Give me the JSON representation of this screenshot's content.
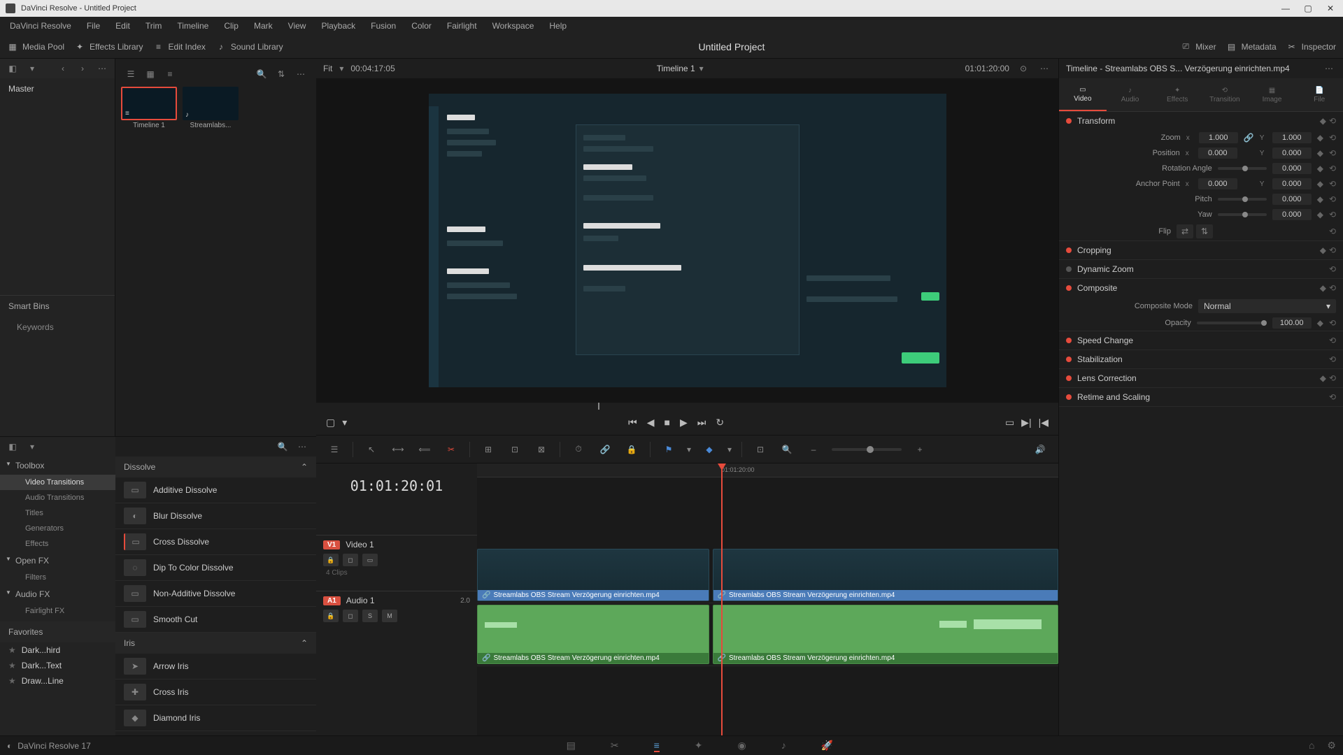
{
  "window": {
    "title": "DaVinci Resolve - Untitled Project"
  },
  "menubar": [
    "DaVinci Resolve",
    "File",
    "Edit",
    "Trim",
    "Timeline",
    "Clip",
    "Mark",
    "View",
    "Playback",
    "Fusion",
    "Color",
    "Fairlight",
    "Workspace",
    "Help"
  ],
  "toolbar": {
    "media_pool": "Media Pool",
    "effects_library": "Effects Library",
    "edit_index": "Edit Index",
    "sound_library": "Sound Library",
    "mixer": "Mixer",
    "metadata": "Metadata",
    "inspector": "Inspector",
    "project_title": "Untitled Project"
  },
  "media": {
    "master": "Master",
    "smart_bins": "Smart Bins",
    "keywords": "Keywords",
    "thumbs": [
      {
        "label": "Timeline 1",
        "icon": "≡"
      },
      {
        "label": "Streamlabs...",
        "icon": "♪"
      }
    ]
  },
  "effects": {
    "toolbox": "Toolbox",
    "categories": [
      {
        "label": "Video Transitions",
        "active": true
      },
      {
        "label": "Audio Transitions",
        "active": false
      },
      {
        "label": "Titles",
        "active": false
      },
      {
        "label": "Generators",
        "active": false
      },
      {
        "label": "Effects",
        "active": false
      }
    ],
    "openfx": "Open FX",
    "filters": "Filters",
    "audiofx": "Audio FX",
    "fairlightfx": "Fairlight FX",
    "favorites": "Favorites",
    "fav_items": [
      "Dark...hird",
      "Dark...Text",
      "Draw...Line"
    ],
    "groups": [
      {
        "name": "Dissolve",
        "items": [
          "Additive Dissolve",
          "Blur Dissolve",
          "Cross Dissolve",
          "Dip To Color Dissolve",
          "Non-Additive Dissolve",
          "Smooth Cut"
        ]
      },
      {
        "name": "Iris",
        "items": [
          "Arrow Iris",
          "Cross Iris",
          "Diamond Iris"
        ]
      }
    ]
  },
  "viewer": {
    "fit": "Fit",
    "tc_left": "00:04:17:05",
    "timeline_name": "Timeline 1",
    "tc_right": "01:01:20:00"
  },
  "timeline": {
    "display_tc": "01:01:20:01",
    "ruler_label": "01:01:20:00",
    "video_track": {
      "badge": "V1",
      "name": "Video 1",
      "clip_count": "4 Clips"
    },
    "audio_track": {
      "badge": "A1",
      "name": "Audio 1",
      "channels": "2.0"
    },
    "clip_name": "Streamlabs OBS Stream Verzögerung einrichten.mp4"
  },
  "inspector": {
    "header": "Timeline - Streamlabs OBS S... Verzögerung einrichten.mp4",
    "tabs": [
      "Video",
      "Audio",
      "Effects",
      "Transition",
      "Image",
      "File"
    ],
    "transform": {
      "title": "Transform",
      "zoom": "Zoom",
      "zoom_x": "1.000",
      "zoom_y": "1.000",
      "position": "Position",
      "pos_x": "0.000",
      "pos_y": "0.000",
      "rotation": "Rotation Angle",
      "rot_val": "0.000",
      "anchor": "Anchor Point",
      "anc_x": "0.000",
      "anc_y": "0.000",
      "pitch": "Pitch",
      "pitch_val": "0.000",
      "yaw": "Yaw",
      "yaw_val": "0.000",
      "flip": "Flip"
    },
    "cropping": "Cropping",
    "dynamic_zoom": "Dynamic Zoom",
    "composite": {
      "title": "Composite",
      "mode_label": "Composite Mode",
      "mode_value": "Normal",
      "opacity_label": "Opacity",
      "opacity_value": "100.00"
    },
    "speed_change": "Speed Change",
    "stabilization": "Stabilization",
    "lens_correction": "Lens Correction",
    "retime": "Retime and Scaling"
  },
  "bottombar": {
    "version": "DaVinci Resolve 17"
  }
}
